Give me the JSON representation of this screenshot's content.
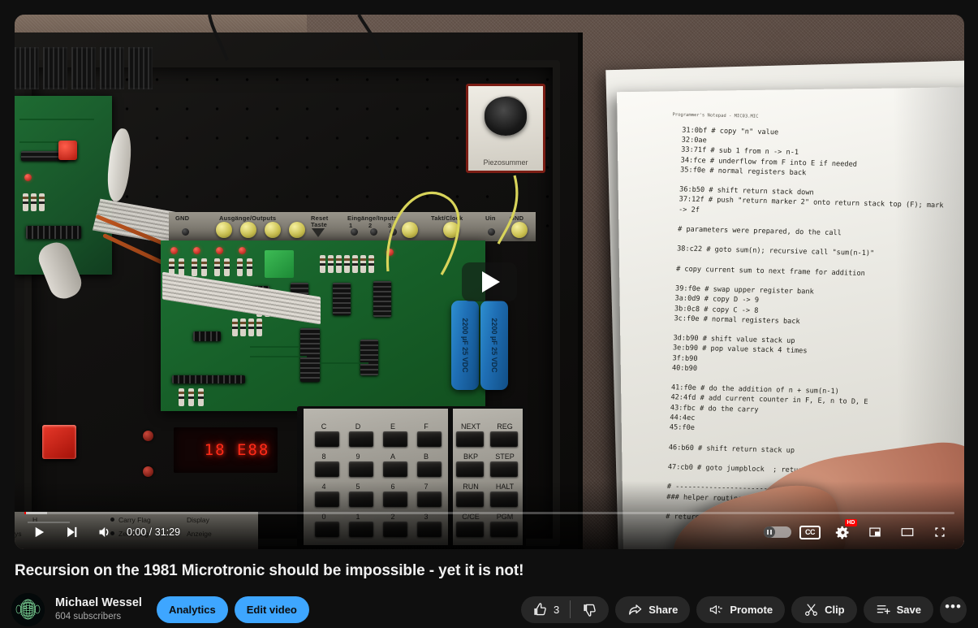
{
  "video": {
    "title": "Recursion on the 1981 Microtronic should be impossible - yet it is not!",
    "current_time": "0:00",
    "duration": "31:29",
    "time_display": "0:00 / 31:29",
    "quality_badge": "HD",
    "cc_label": "CC",
    "progress_percent": 0,
    "accent_color": "#ff0000"
  },
  "player_controls": {
    "play": "play-button",
    "next": "next-video-button",
    "volume": "volume-button",
    "autoplay": "autoplay-toggle",
    "subtitles": "subtitles-button",
    "settings": "settings-button",
    "miniplayer": "miniplayer-button",
    "theater": "theater-mode-button",
    "fullscreen": "fullscreen-button"
  },
  "channel": {
    "name": "Michael Wessel",
    "subscribers": "604 subscribers"
  },
  "buttons": {
    "analytics": "Analytics",
    "edit_video": "Edit video",
    "share": "Share",
    "promote": "Promote",
    "clip": "Clip",
    "save": "Save",
    "more": "•••",
    "like_count": "3"
  },
  "colors": {
    "brand_blue": "#3ea6ff",
    "chip_dark": "#272727",
    "background": "#0f0f0f",
    "text_primary": "#f1f1f1",
    "text_secondary": "#aaaaaa"
  },
  "scene": {
    "piezo_label": "Piezosummer",
    "capacitor_1": "2200 µF 25 VDC",
    "capacitor_2": "2200 µF 25 VDC",
    "led_display": "18  E88",
    "board_labels": {
      "gnd_left": "GND",
      "outputs": "Ausgänge/Outputs",
      "reset": "Reset",
      "reset_2": "Taste",
      "inputs": "Eingänge/Inputs",
      "in_1": "1",
      "in_2": "2",
      "in_3": "3",
      "clock": "Takt/Clock",
      "uin": "Uin",
      "gnd_right": "GND"
    },
    "panel_labels": {
      "h": "H",
      "ys": "ys",
      "carry_flag": "Carry Flag",
      "zero_flag": "Zero-Flag",
      "display": "Display",
      "anzeige": "Anzeige"
    },
    "keypad": {
      "hex_keys": [
        "C",
        "D",
        "E",
        "F",
        "8",
        "9",
        "A",
        "B",
        "4",
        "5",
        "6",
        "7",
        "0",
        "1",
        "2",
        "3"
      ],
      "function_keys": [
        "NEXT",
        "REG",
        "BKP",
        "STEP",
        "RUN",
        "HALT",
        "C/CE",
        "PGM"
      ]
    },
    "paper_header": "Programmer's Notepad - MIC03.MIC",
    "paper_code": "31:0bf # copy \"n\" value\n32:0ae\n33:71f # sub 1 from n -> n-1\n34:fce # underflow from F into E if needed\n35:f0e # normal registers back\n\n36:b50 # shift return stack down\n37:12f # push \"return marker 2\" onto return stack top (F); mark\n-> 2f\n\n# parameters were prepared, do the call\n\n38:c22 # goto sum(n); recursive call \"sum(n-1)\"\n\n# copy current sum to next frame for addition\n\n39:f0e # swap upper register bank\n3a:0d9 # copy D -> 9\n3b:0c8 # copy C -> 8\n3c:f0e # normal registers back\n\n3d:b90 # shift value stack up\n3e:b90 # pop value stack 4 times\n3f:b90\n40:b90\n\n41:f0e # do the addition of n + sum(n-1)\n42:4fd # add current counter in F, E, n to D, E\n43:fbc # do the carry\n44:4ec\n45:f0e\n\n46:b60 # shift return stack up\n\n47:cb0 # goto jumpblock  ; return\n\n# ------------------------------\n### helper routines\n\n# return stack"
  }
}
